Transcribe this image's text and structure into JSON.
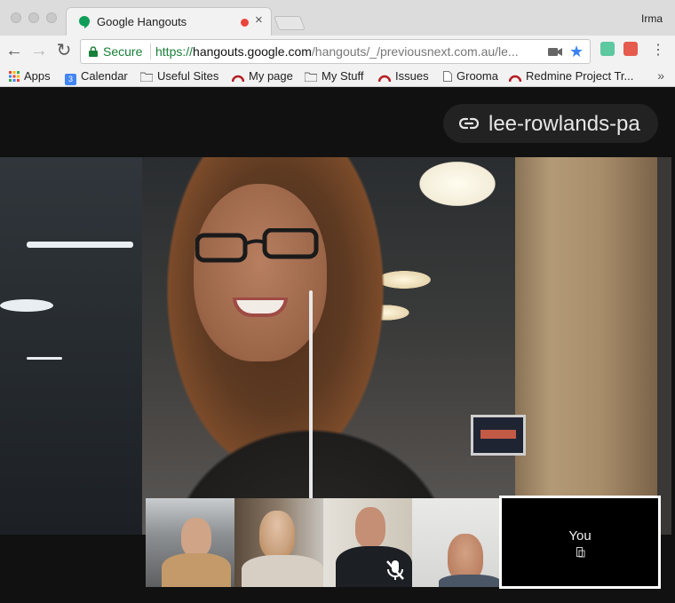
{
  "browser": {
    "tab": {
      "title": "Google Hangouts",
      "favicon": "hangouts-icon",
      "recording_icon": "record-dot-icon",
      "close_label": "×"
    },
    "user": "Irma",
    "address_bar": {
      "secure_label": "Secure",
      "url_scheme": "https://",
      "url_host": "hangouts.google.com",
      "url_path": "/hangouts/_/previousnext.com.au/le..."
    },
    "nav": {
      "back": "←",
      "forward": "→",
      "reload": "↻",
      "menu": "⋮",
      "star": "★"
    },
    "bookmarks": [
      {
        "label": "Apps",
        "icon": "apps-grid-icon"
      },
      {
        "label": "Calendar",
        "icon": "calendar-icon"
      },
      {
        "label": "Useful Sites",
        "icon": "folder-icon"
      },
      {
        "label": "My page",
        "icon": "redmine-icon"
      },
      {
        "label": "My Stuff",
        "icon": "folder-icon"
      },
      {
        "label": "Issues",
        "icon": "redmine-icon"
      },
      {
        "label": "Grooma",
        "icon": "page-icon"
      },
      {
        "label": "Redmine Project Tr...",
        "icon": "redmine-icon"
      }
    ],
    "bookmarks_more": "»",
    "calendar_day": "3"
  },
  "hangout": {
    "room_name": "lee-rowlands-pa",
    "self_label": "You",
    "participants": [
      {
        "muted": false
      },
      {
        "muted": false
      },
      {
        "muted": true
      },
      {
        "muted": false
      }
    ]
  },
  "colors": {
    "secure_green": "#188038",
    "star_blue": "#3b82f6",
    "recording_red": "#e8453c"
  }
}
